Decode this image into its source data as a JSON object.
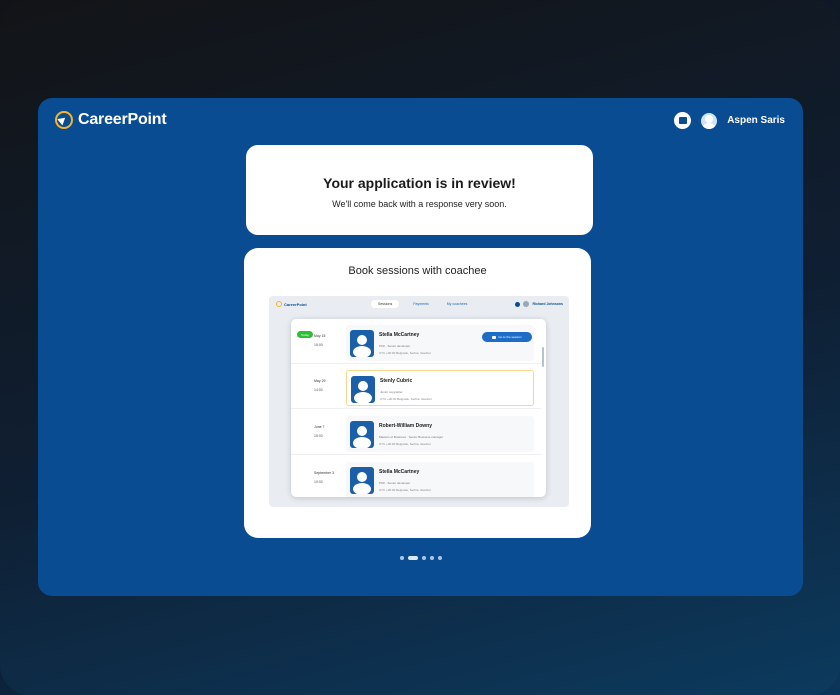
{
  "header": {
    "brand": "CareerPoint",
    "user_name": "Aspen Saris"
  },
  "review": {
    "title": "Your application is in review!",
    "subtitle": "We'll come back with a response very soon."
  },
  "sessions": {
    "title": "Book sessions with coachee",
    "preview": {
      "brand": "CareerPoint",
      "tabs": [
        "Sessions",
        "Payments",
        "My coachees"
      ],
      "active_tab": 0,
      "user_name": "Richard Johnsons",
      "today_label": "Today",
      "go_button_label": "Go to the session",
      "rows": [
        {
          "date": "May 15",
          "time": "15:00",
          "name": "Stella McCartney",
          "role": "PhD · Senior developer",
          "location": "UTC +00:00 Belgrade, Serbia, Istanbul",
          "today": true,
          "highlight": false,
          "button": true
        },
        {
          "date": "May 29",
          "time": "14:00",
          "name": "Stenly Cubric",
          "role": "Junior copywriter",
          "location": "UTC +00:00 Belgrade, Serbia, Istanbul",
          "today": false,
          "highlight": true,
          "button": false
        },
        {
          "date": "June 7",
          "time": "15:00",
          "name": "Robert-William Downy",
          "role": "Masters of Business · Senior Business manager",
          "location": "UTC +00:00 Belgrade, Serbia, Istanbul",
          "today": false,
          "highlight": false,
          "button": false
        },
        {
          "date": "September 3",
          "time": "10:00",
          "name": "Stella McCartney",
          "role": "PhD · Senior developer",
          "location": "UTC +00:00 Belgrade, Serbia, Istanbul",
          "today": false,
          "highlight": false,
          "button": false
        }
      ]
    }
  },
  "pagination": {
    "count": 5,
    "active": 1
  },
  "colors": {
    "app_background": "#0a4c92",
    "accent_yellow": "#f7b32b",
    "today_green": "#2fbd3a",
    "button_blue": "#1d6cc6"
  },
  "icons": {
    "logo": "compass-arrow-icon",
    "calendar": "calendar-icon",
    "user": "user-avatar-icon",
    "camera": "video-camera-icon"
  }
}
